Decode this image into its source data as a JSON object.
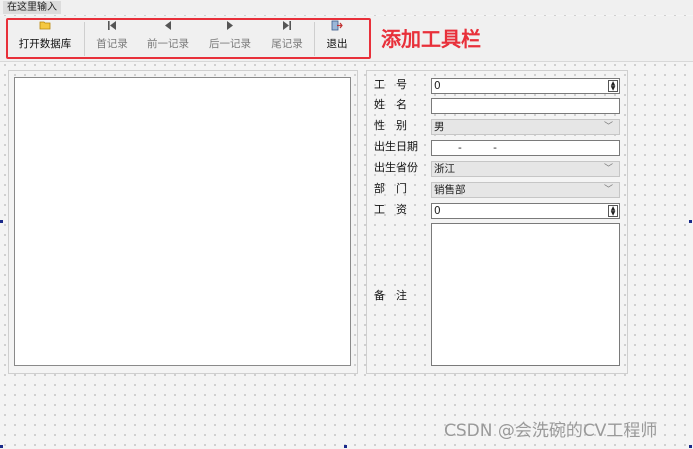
{
  "menubar": {
    "item_label": "在这里输入"
  },
  "toolbar": {
    "buttons": [
      {
        "label": "打开数据库",
        "icon": "folder-open-icon",
        "enabled": true
      },
      {
        "label": "首记录",
        "icon": "first-record-icon",
        "enabled": false
      },
      {
        "label": "前一记录",
        "icon": "previous-record-icon",
        "enabled": false
      },
      {
        "label": "后一记录",
        "icon": "next-record-icon",
        "enabled": false
      },
      {
        "label": "尾记录",
        "icon": "last-record-icon",
        "enabled": false
      },
      {
        "label": "退出",
        "icon": "exit-icon",
        "enabled": true
      }
    ]
  },
  "annotation": {
    "text": "添加工具栏",
    "color": "#e8303a"
  },
  "form": {
    "employee_id": {
      "label": "工　号",
      "value": "0"
    },
    "name": {
      "label": "姓　名",
      "value": ""
    },
    "gender": {
      "label": "性　别",
      "value": "男"
    },
    "birth_date": {
      "label": "出生日期",
      "value": "-  -"
    },
    "province": {
      "label": "出生省份",
      "value": "浙江"
    },
    "department": {
      "label": "部　门",
      "value": "销售部"
    },
    "salary": {
      "label": "工　资",
      "value": "0"
    },
    "remarks": {
      "label": "备　注",
      "value": ""
    }
  },
  "watermark": {
    "text": "CSDN @会洗碗的CV工程师"
  },
  "colors": {
    "highlight": "#e8303a",
    "window_bg": "#f0f0f0",
    "selection_handle": "#1a2a8a"
  }
}
